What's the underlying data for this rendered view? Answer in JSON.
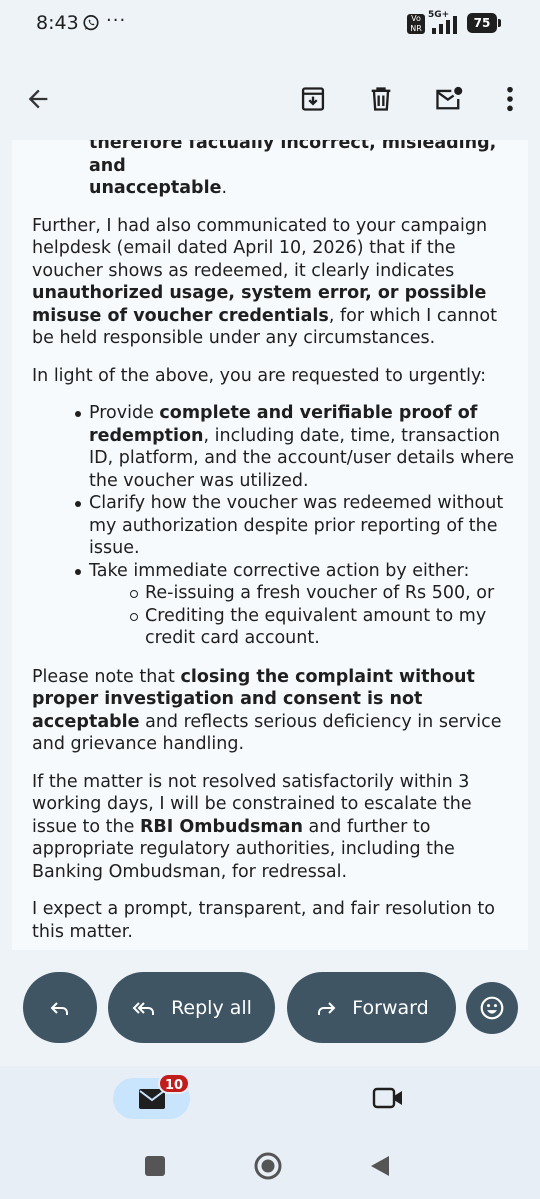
{
  "status_bar": {
    "time": "8:43",
    "overflow": "···",
    "volte": "Vo NR",
    "network": "5G+",
    "battery": "75",
    "icons": [
      "whatsapp-icon",
      "signal-icon",
      "battery-icon"
    ]
  },
  "toolbar": {
    "icons": [
      "back-arrow-icon",
      "archive-icon",
      "delete-icon",
      "mark-unread-icon",
      "more-vert-icon"
    ]
  },
  "email": {
    "clipped_line_top": "therefore factually incorrect, misleading, and",
    "clipped_line_bold": "unacceptable",
    "clipped_line_end": ".",
    "p1_a": "Further, I had also communicated to your campaign helpdesk (email dated April 10, 2026) that if the voucher shows as redeemed, it clearly indicates ",
    "p1_b": "unauthorized usage, system error, or possible misuse of voucher credentials",
    "p1_c": ", for which I cannot be held responsible under any circumstances.",
    "p2": "In light of the above, you are requested to urgently:",
    "bullet1_a": "Provide ",
    "bullet1_b": "complete and verifiable proof of redemption",
    "bullet1_c": ", including date, time, transaction ID, platform, and the account/user details where the voucher was utilized.",
    "bullet2": "Clarify how the voucher was redeemed without my authorization despite prior reporting of the issue.",
    "bullet3": "Take immediate corrective action by either:",
    "sub1": "Re-issuing a fresh voucher of Rs 500, or",
    "sub2": "Crediting the equivalent amount to my credit card account.",
    "p3_a": "Please note that ",
    "p3_b": "closing the complaint without proper investigation and consent is not acceptable",
    "p3_c": " and reflects serious deficiency in service and grievance handling.",
    "p4_a": "If the matter is not resolved satisfactorily within 3 working days, I will be constrained to escalate the issue to the ",
    "p4_b": "RBI Ombudsman",
    "p4_c": " and further to appropriate regulatory authorities, including the Banking Ombudsman, for redressal.",
    "p5": "I expect a prompt, transparent, and fair resolution to this matter."
  },
  "actions": {
    "reply_all_label": "Reply all",
    "forward_label": "Forward"
  },
  "bottom_nav": {
    "mail_badge": "10"
  },
  "colors": {
    "pill_bg": "#3f5563",
    "card_bg": "#f7fafd",
    "page_bg": "#eef3f8",
    "nav_bg": "#e8eef5",
    "mail_tab_active": "#c9e5fd",
    "badge_red": "#c21d1d"
  }
}
